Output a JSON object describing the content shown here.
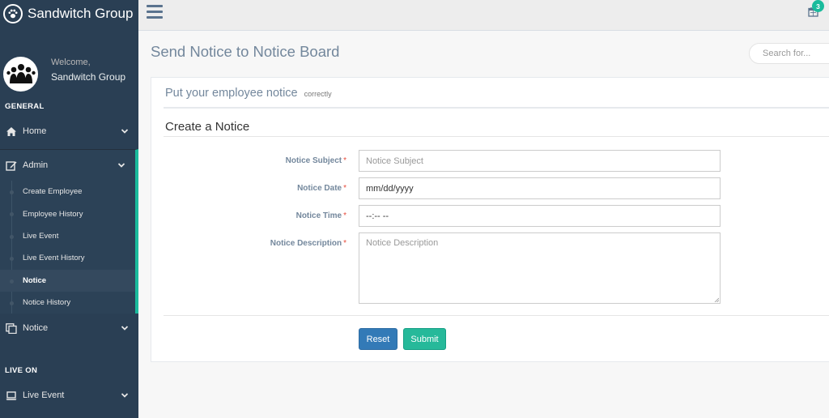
{
  "brand": {
    "name": "Sandwitch Group",
    "logo_icon": "paw-icon"
  },
  "profile": {
    "welcome": "Welcome,",
    "name": "Sandwitch Group",
    "avatar_icon": "group-users-icon"
  },
  "sidebar": {
    "general_title": "GENERAL",
    "home": {
      "label": "Home",
      "icon": "home-icon"
    },
    "admin": {
      "label": "Admin",
      "icon": "edit-icon",
      "items": [
        {
          "label": "Create Employee"
        },
        {
          "label": "Employee History"
        },
        {
          "label": "Live Event"
        },
        {
          "label": "Live Event History"
        },
        {
          "label": "Notice"
        },
        {
          "label": "Notice History"
        }
      ],
      "active_item": "Notice"
    },
    "notice": {
      "label": "Notice",
      "icon": "clone-icon"
    },
    "live_on_title": "LIVE ON",
    "live_event": {
      "label": "Live Event",
      "icon": "laptop-icon"
    }
  },
  "topnav": {
    "notification_count": "3",
    "menu_icon": "hamburger-icon",
    "notification_icon": "calendar-icon"
  },
  "page": {
    "title": "Send Notice to Notice Board",
    "search_placeholder": "Search for..."
  },
  "panel": {
    "title": "Put your employee notice",
    "subtitle": "correctly",
    "form_title": "Create a Notice"
  },
  "form": {
    "subject": {
      "label": "Notice Subject",
      "required": "*",
      "placeholder": "Notice Subject"
    },
    "date": {
      "label": "Notice Date",
      "required": "*",
      "value": "mm/dd/yyyy"
    },
    "time": {
      "label": "Notice Time",
      "required": "*",
      "value": "--:-- --"
    },
    "description": {
      "label": "Notice Description",
      "required": "*",
      "placeholder": "Notice Description"
    },
    "reset_label": "Reset",
    "submit_label": "Submit"
  },
  "colors": {
    "sidebar_bg": "#2a3f54",
    "accent": "#1abb9c",
    "primary_button": "#337ab7",
    "success_button": "#26b99a"
  }
}
